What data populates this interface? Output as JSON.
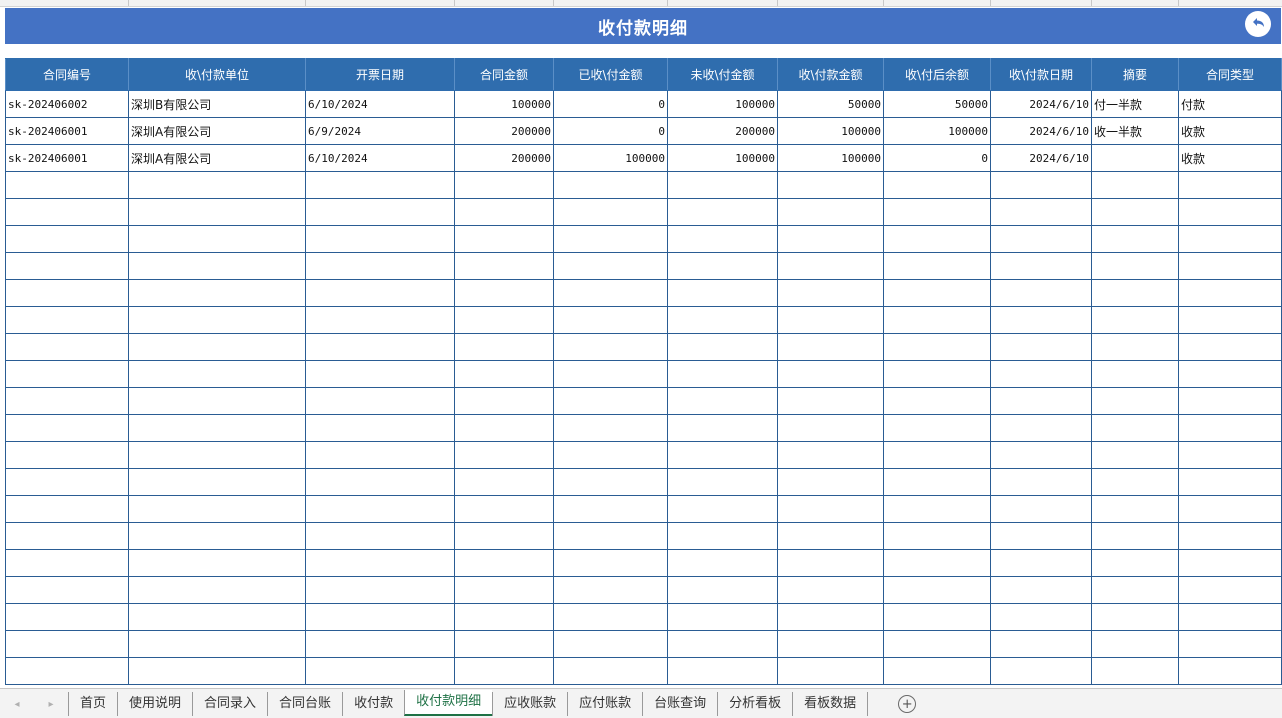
{
  "colors": {
    "title_bg": "#4472c4",
    "header_bg": "#2f6dae",
    "grid_line": "#2a5c93",
    "active_tab": "#1e7145"
  },
  "title_bar": {
    "title": "收付款明细",
    "back_icon": "return-arrow-icon"
  },
  "table": {
    "columns": [
      "合同编号",
      "收\\付款单位",
      "开票日期",
      "合同金额",
      "已收\\付金额",
      "未收\\付金额",
      "收\\付款金额",
      "收\\付后余额",
      "收\\付款日期",
      "摘要",
      "合同类型"
    ],
    "rows": [
      [
        "sk-202406002",
        "深圳B有限公司",
        "6/10/2024",
        "100000",
        "0",
        "100000",
        "50000",
        "50000",
        "2024/6/10",
        "付一半款",
        "付款"
      ],
      [
        "sk-202406001",
        "深圳A有限公司",
        "6/9/2024",
        "200000",
        "0",
        "200000",
        "100000",
        "100000",
        "2024/6/10",
        "收一半款",
        "收款"
      ],
      [
        "sk-202406001",
        "深圳A有限公司",
        "6/10/2024",
        "200000",
        "100000",
        "100000",
        "100000",
        "0",
        "2024/6/10",
        "",
        "收款"
      ]
    ]
  },
  "sheet_tabs": {
    "tabs": [
      "首页",
      "使用说明",
      "合同录入",
      "合同台账",
      "收付款",
      "收付款明细",
      "应收账款",
      "应付账款",
      "台账查询",
      "分析看板",
      "看板数据"
    ],
    "active": "收付款明细",
    "add_icon": "plus-circle-icon"
  }
}
